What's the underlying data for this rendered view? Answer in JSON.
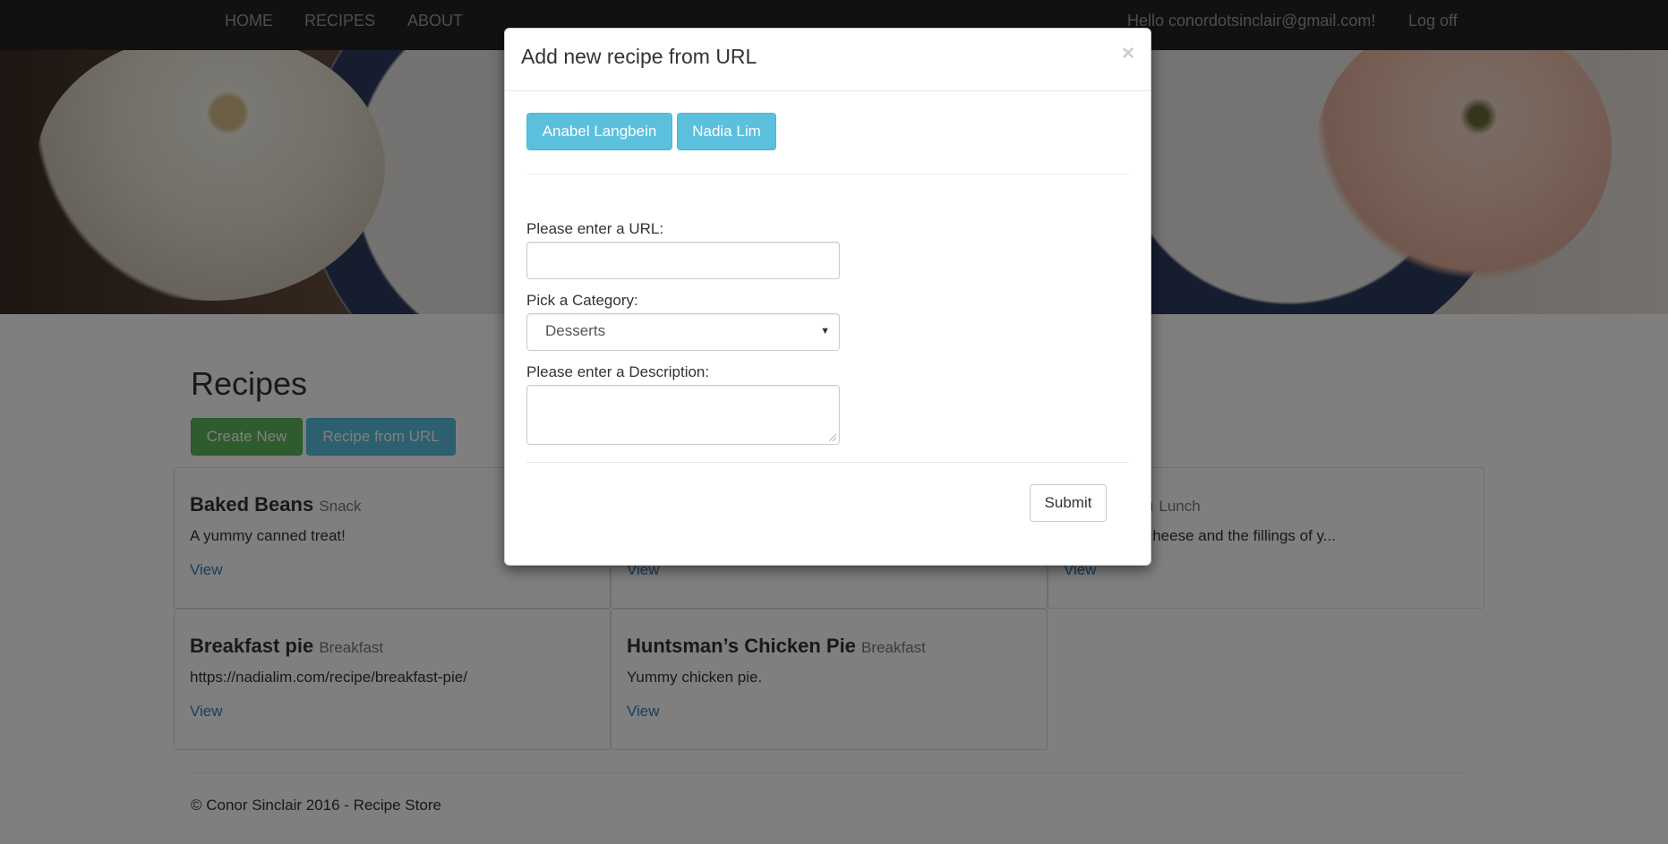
{
  "navbar": {
    "links": [
      "HOME",
      "RECIPES",
      "ABOUT"
    ],
    "greeting": "Hello conordotsinclair@gmail.com!",
    "logoff": "Log off"
  },
  "page": {
    "title": "Recipes",
    "create_new_label": "Create New",
    "recipe_from_url_label": "Recipe from URL"
  },
  "recipes": [
    {
      "title": "Baked Beans",
      "category": "Snack",
      "description": "A yummy canned treat!",
      "view": "View"
    },
    {
      "title": "",
      "category": "",
      "description": "",
      "view": "View"
    },
    {
      "title": "sandwich",
      "category": "Lunch",
      "description": "with melted cheese and the fillings of y...",
      "view": "View"
    },
    {
      "title": "Breakfast pie",
      "category": "Breakfast",
      "description": "https://nadialim.com/recipe/breakfast-pie/",
      "view": "View"
    },
    {
      "title": "Huntsman’s Chicken Pie",
      "category": "Breakfast",
      "description": "Yummy chicken pie.",
      "view": "View"
    }
  ],
  "footer": "© Conor Sinclair 2016 - Recipe Store",
  "modal": {
    "title": "Add new recipe from URL",
    "close": "×",
    "sources": [
      "Anabel Langbein",
      "Nadia Lim"
    ],
    "url_label": "Please enter a URL:",
    "url_value": "",
    "category_label": "Pick a Category:",
    "category_selected": "Desserts",
    "description_label": "Please enter a Description:",
    "description_value": "",
    "submit_label": "Submit"
  },
  "colors": {
    "navbar": "#222222",
    "success": "#5cb85c",
    "info": "#5bc0de",
    "link": "#337ab7"
  }
}
